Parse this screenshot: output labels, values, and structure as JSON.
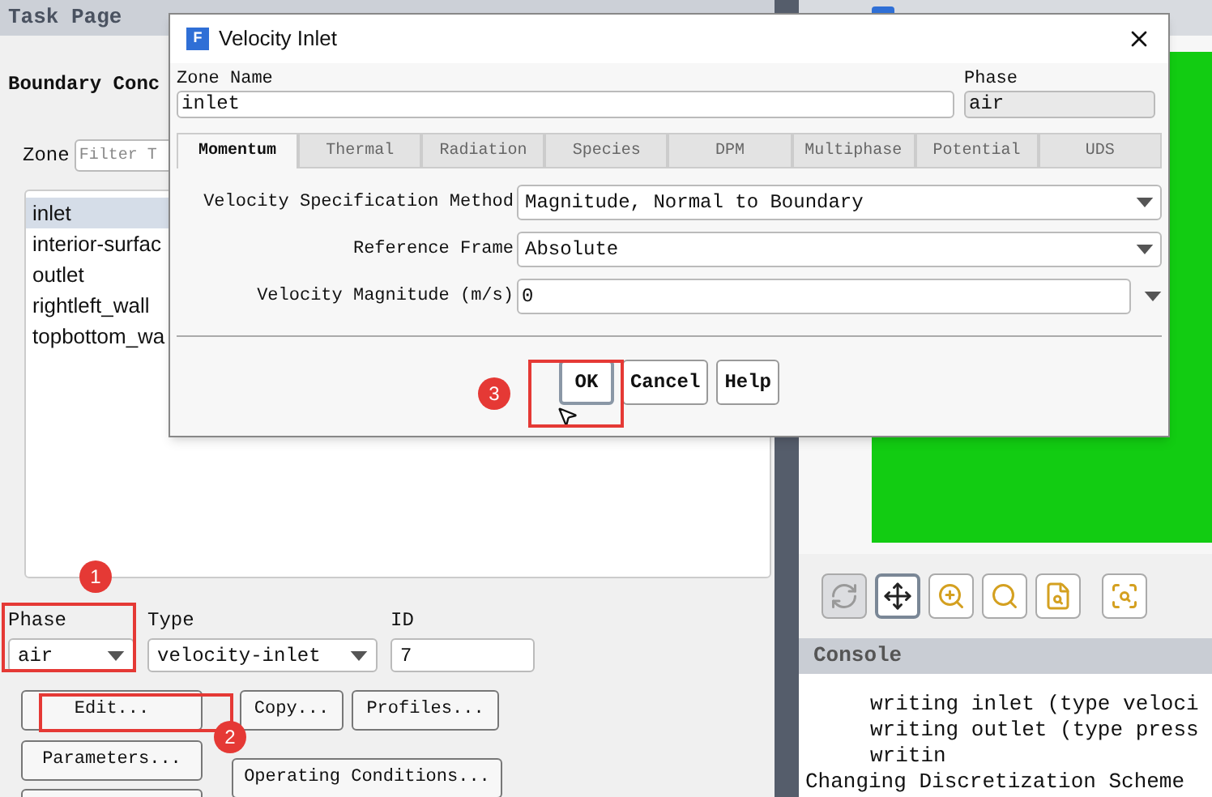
{
  "task_page": {
    "title": "Task Page",
    "heading": "Boundary Conc",
    "zone_label": "Zone",
    "filter": {
      "placeholder": "Filter T"
    },
    "zones": [
      {
        "label": "inlet",
        "selected": true
      },
      {
        "label": "interior-surfac",
        "selected": false
      },
      {
        "label": "outlet",
        "selected": false
      },
      {
        "label": "rightleft_wall",
        "selected": false
      },
      {
        "label": "topbottom_wa",
        "selected": false
      }
    ],
    "phase": {
      "label": "Phase",
      "value": "air"
    },
    "type": {
      "label": "Type",
      "value": "velocity-inlet"
    },
    "id": {
      "label": "ID",
      "value": "7"
    },
    "buttons": [
      "Edit...",
      "Copy...",
      "Profiles...",
      "Parameters...",
      "Operating Conditions..."
    ]
  },
  "dialog": {
    "logo": "F",
    "title": "Velocity Inlet",
    "zone_name": {
      "label": "Zone Name",
      "value": "inlet"
    },
    "phase": {
      "label": "Phase",
      "value": "air"
    },
    "tabs": [
      {
        "label": "Momentum",
        "selected": true
      },
      {
        "label": "Thermal",
        "selected": false
      },
      {
        "label": "Radiation",
        "selected": false
      },
      {
        "label": "Species",
        "selected": false
      },
      {
        "label": "DPM",
        "selected": false
      },
      {
        "label": "Multiphase",
        "selected": false
      },
      {
        "label": "Potential",
        "selected": false
      },
      {
        "label": "UDS",
        "selected": false
      }
    ],
    "fields": [
      {
        "label": "Velocity Specification Method",
        "value": "Magnitude, Normal to Boundary",
        "kind": "select"
      },
      {
        "label": "Reference Frame",
        "value": "Absolute",
        "kind": "select"
      },
      {
        "label": "Velocity Magnitude (m/s)",
        "value": "0",
        "kind": "input"
      }
    ],
    "buttons": [
      {
        "label": "OK",
        "selected": true
      },
      {
        "label": "Cancel",
        "selected": false
      },
      {
        "label": "Help",
        "selected": false
      }
    ]
  },
  "toolbar": [
    {
      "kind": "rotate",
      "selected": false,
      "disabled": true
    },
    {
      "kind": "pan",
      "selected": true,
      "disabled": false
    },
    {
      "kind": "zoominout",
      "selected": false,
      "disabled": false
    },
    {
      "kind": "zoom",
      "selected": false,
      "disabled": false
    },
    {
      "kind": "zoomdoc",
      "selected": false,
      "disabled": false
    },
    {
      "kind": "zoombox",
      "selected": false,
      "disabled": false
    }
  ],
  "console": {
    "title": "Console",
    "lines": [
      {
        "text": "writing inlet (type veloci",
        "indented": true
      },
      {
        "text": "writing outlet (type press",
        "indented": true
      },
      {
        "text": "writin",
        "indented": true
      },
      {
        "text": "Changing Discretization Scheme",
        "indented": false
      }
    ]
  },
  "annotations": [
    "1",
    "2",
    "3"
  ]
}
